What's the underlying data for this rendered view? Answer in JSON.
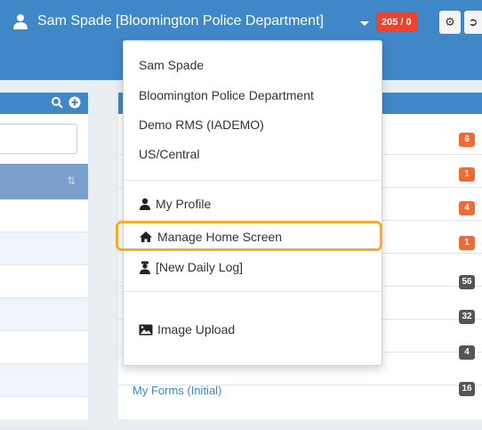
{
  "header": {
    "user_label": "Sam Spade [Bloomington Police Department]",
    "counter": "205 / 0"
  },
  "dropdown": {
    "info": [
      "Sam Spade",
      "Bloomington Police Department",
      "Demo RMS (IADEMO)",
      "US/Central"
    ],
    "items": [
      {
        "label": "My Profile",
        "icon": "user-icon"
      },
      {
        "label": "Manage Home Screen",
        "icon": "home-icon"
      },
      {
        "label": "[New Daily Log]",
        "icon": "officer-icon"
      },
      {
        "label": "Image Upload",
        "icon": "image-icon"
      }
    ],
    "highlighted_item": "Manage Home Screen"
  },
  "right_panel": {
    "badges": [
      "6",
      "1",
      "4",
      "1",
      "56",
      "32",
      "4",
      "16"
    ],
    "forms_link": "My Forms (Initial)"
  },
  "colors": {
    "header_blue": "#3f87c6",
    "badge_orange": "#f06a34",
    "badge_gray": "#555555",
    "highlight": "#f5ac29",
    "counter_red": "#e8442f"
  }
}
